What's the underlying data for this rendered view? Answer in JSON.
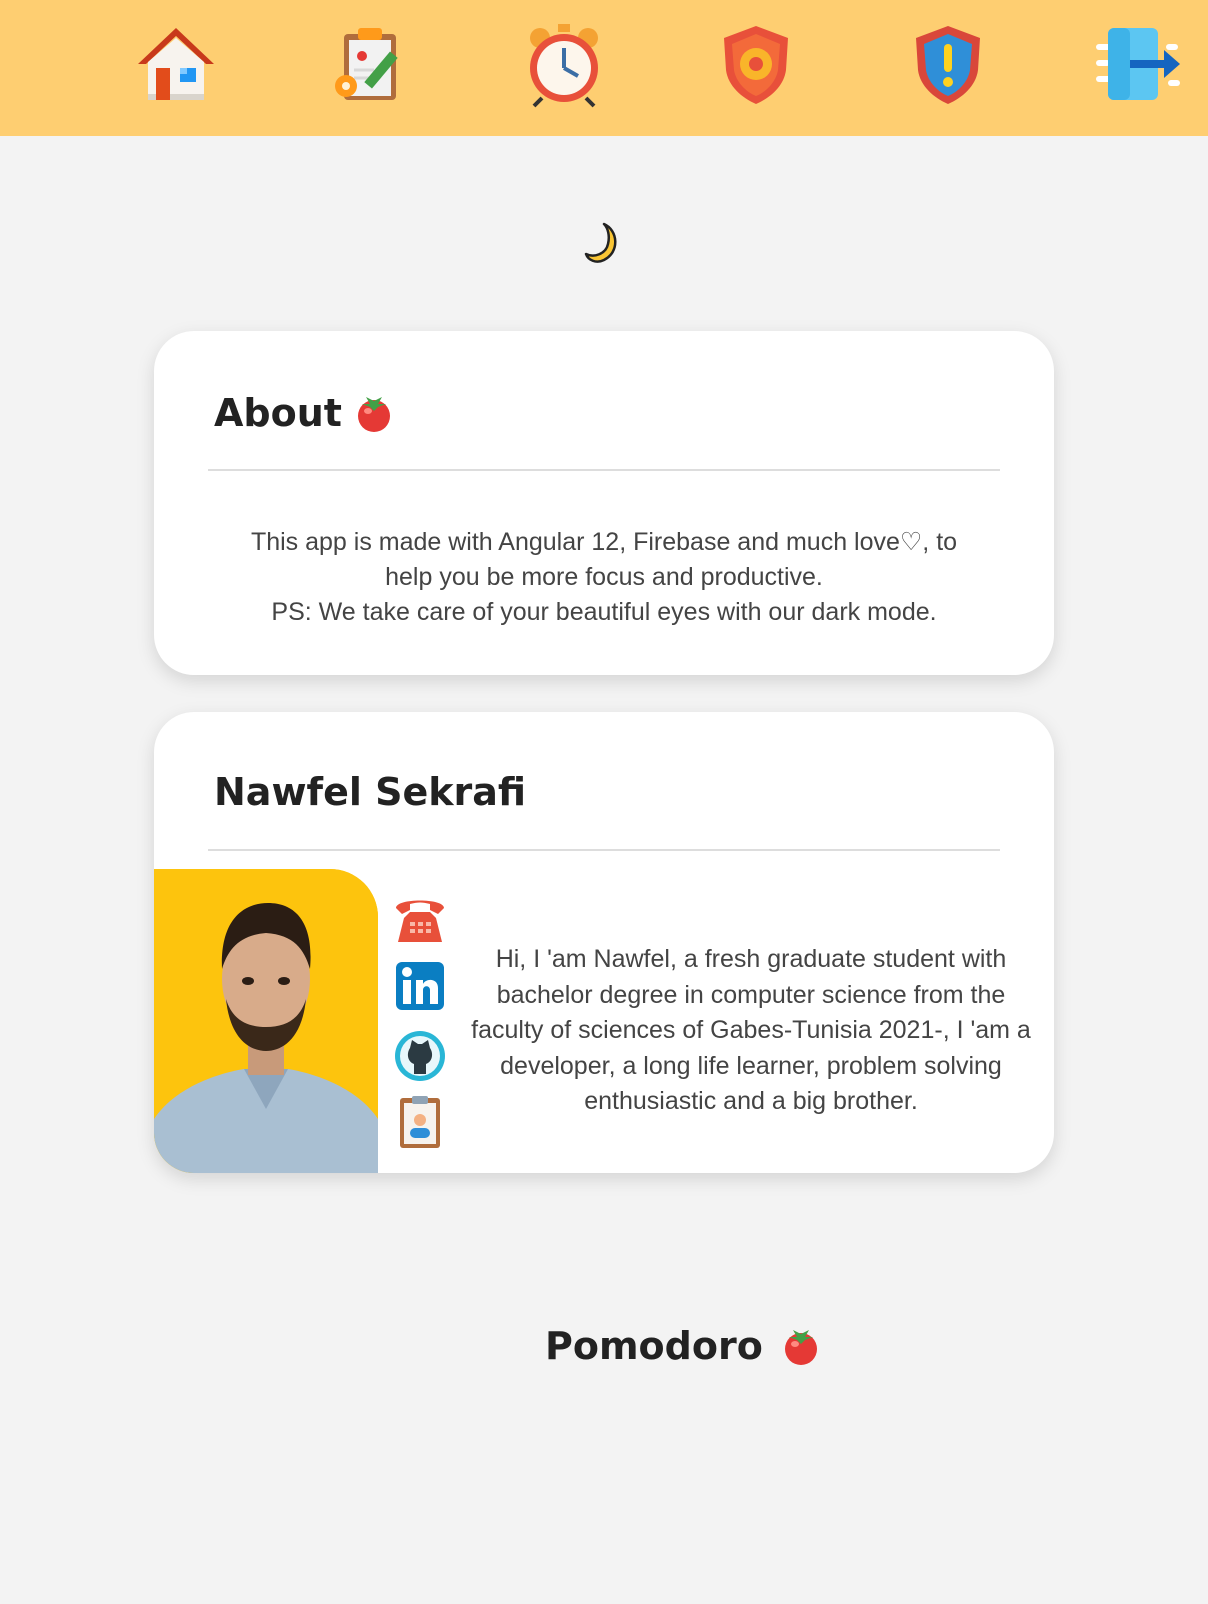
{
  "nav": {
    "items": [
      {
        "icon": "home-icon"
      },
      {
        "icon": "tasks-clipboard-icon"
      },
      {
        "icon": "alarm-clock-icon"
      },
      {
        "icon": "settings-shield-icon"
      },
      {
        "icon": "warning-shield-icon"
      },
      {
        "icon": "logout-icon"
      }
    ]
  },
  "theme_toggle": {
    "icon": "moon-icon"
  },
  "about": {
    "title": "About",
    "title_icon": "tomato-icon",
    "lines": [
      "This app is made with Angular 12, Firebase and much love♡, to",
      "help you be more focus and productive.",
      "PS: We take care of your beautiful eyes with our dark mode."
    ]
  },
  "author": {
    "name": "Nawfel Sekrafi",
    "photo": "profile-photo",
    "contacts": [
      {
        "icon": "phone-icon"
      },
      {
        "icon": "linkedin-icon"
      },
      {
        "icon": "github-icon"
      },
      {
        "icon": "resume-icon"
      }
    ],
    "bio_lines": [
      "Hi, I 'am Nawfel, a fresh graduate student with",
      "bachelor degree in computer science from the",
      "faculty of sciences of Gabes-Tunisia 2021-, I 'am a",
      "developer, a long life learner, problem solving",
      "enthusiastic and a big brother."
    ]
  },
  "footer": {
    "brand": "Pomodoro",
    "brand_icon": "tomato-icon"
  },
  "colors": {
    "nav_background": "#fece71",
    "page_background": "#f3f3f3",
    "card_background": "#ffffff",
    "photo_background": "#fdc40d"
  }
}
